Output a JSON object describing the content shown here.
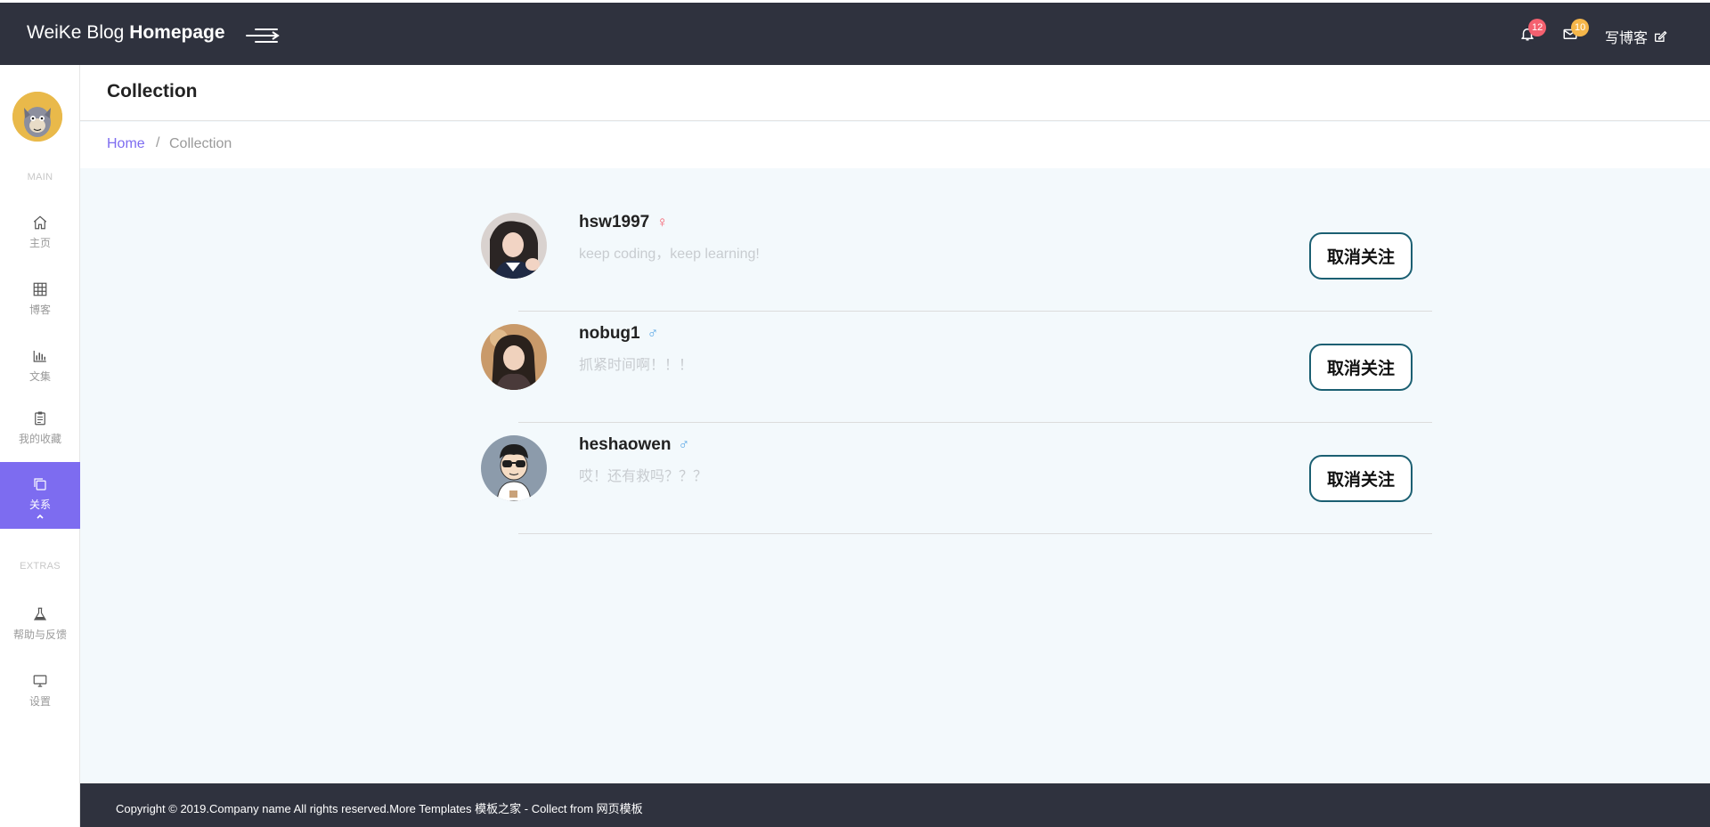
{
  "header": {
    "brand_light": "WeiKe Blog",
    "brand_bold": "Homepage",
    "notifications_count": "12",
    "messages_count": "10",
    "write_label": "写博客",
    "colors": {
      "bar": "#2f323e",
      "badge_notify": "#f4606f",
      "badge_msg": "#f5b64a",
      "accent": "#7d6cf0"
    }
  },
  "sidebar": {
    "section_main": "MAIN",
    "section_extras": "EXTRAS",
    "items": [
      {
        "label": "主页",
        "icon": "home-icon"
      },
      {
        "label": "博客",
        "icon": "grid-icon"
      },
      {
        "label": "文集",
        "icon": "bar-chart-icon"
      },
      {
        "label": "我的收藏",
        "icon": "clipboard-icon"
      },
      {
        "label": "关系",
        "icon": "copy-icon",
        "active": true
      },
      {
        "label": "帮助与反馈",
        "icon": "flask-icon"
      },
      {
        "label": "设置",
        "icon": "monitor-icon"
      }
    ]
  },
  "page": {
    "title": "Collection",
    "breadcrumb_home": "Home",
    "breadcrumb_sep": "/",
    "breadcrumb_current": "Collection"
  },
  "follows": [
    {
      "name": "hsw1997",
      "gender": "♀",
      "gender_color": "#f4606f",
      "bio": "keep coding，keep learning!",
      "button": "取消关注"
    },
    {
      "name": "nobug1",
      "gender": "♂",
      "gender_color": "#5ba8e6",
      "bio": "抓紧时间啊！！！",
      "button": "取消关注"
    },
    {
      "name": "heshaowen",
      "gender": "♂",
      "gender_color": "#5ba8e6",
      "bio": "哎！还有救吗？？？",
      "button": "取消关注"
    }
  ],
  "footer": {
    "text": "Copyright © 2019.Company name All rights reserved.More Templates 模板之家 - Collect from 网页模板"
  }
}
